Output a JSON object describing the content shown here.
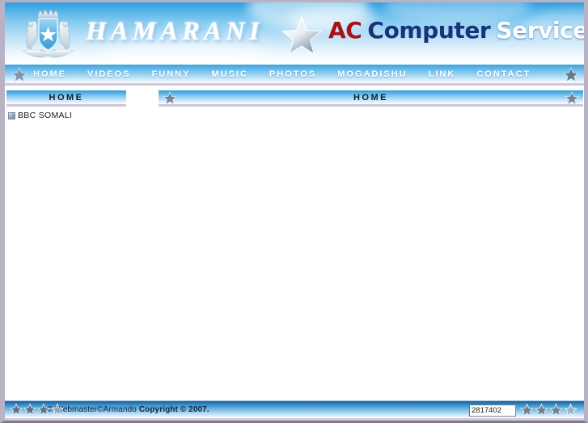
{
  "site": {
    "brand_script": "HAMARANI",
    "logo": {
      "part1": "AC",
      "part2": "Computer",
      "part3": "Service",
      "part1_color": "#a80f17",
      "part2_color": "#17337a",
      "part3_color": "#ffffff"
    },
    "crest_name": "somali-coat-of-arms"
  },
  "nav": {
    "items": [
      {
        "label": "HOME",
        "name": "nav-item-home"
      },
      {
        "label": "VIDEOS",
        "name": "nav-item-videos"
      },
      {
        "label": "FUNNY",
        "name": "nav-item-funny"
      },
      {
        "label": "MUSIC",
        "name": "nav-item-music"
      },
      {
        "label": "PHOTOS",
        "name": "nav-item-photos"
      },
      {
        "label": "MOGADISHU",
        "name": "nav-item-mogadishu"
      },
      {
        "label": "LINK",
        "name": "nav-item-link"
      },
      {
        "label": "CONTACT",
        "name": "nav-item-contact"
      }
    ]
  },
  "sidebar": {
    "title": "HOME",
    "links": [
      {
        "label": "BBC SOMALI"
      }
    ]
  },
  "main": {
    "title": "HOME",
    "body_text": ""
  },
  "footer": {
    "copyright_pre": "© Webmaster©Armando ",
    "copyright_bold": "Copyright © 2007.",
    "counter_value": "2817402",
    "counter_placeholder": "",
    "star_count_left": 4,
    "star_count_right": 4
  },
  "colors": {
    "accent_blue": "#2e9ede",
    "frame_border": "#b9b2c4",
    "bar_border": "#cfc8d9",
    "logo_red": "#a80f17",
    "logo_navy": "#17337a"
  }
}
